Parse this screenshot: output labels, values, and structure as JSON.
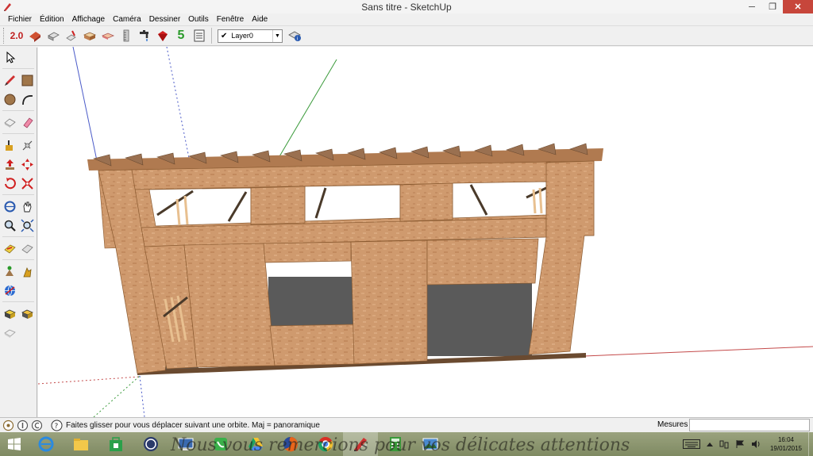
{
  "window": {
    "title": "Sans titre - SketchUp",
    "minimize_glyph": "─",
    "maximize_glyph": "❐",
    "close_glyph": "✕"
  },
  "menu": [
    "Fichier",
    "Édition",
    "Affichage",
    "Caméra",
    "Dessiner",
    "Outils",
    "Fenêtre",
    "Aide"
  ],
  "toolbar": {
    "version_badge": "2.0",
    "five_badge": "5",
    "icons": [
      "warehouse-2-icon",
      "push-block-icon",
      "paint-bucket-icon",
      "box-icon",
      "sandbox-icon",
      "ruler-icon",
      "faucet-icon",
      "red-gem-icon",
      "green-five-icon",
      "report-icon"
    ],
    "layer": {
      "check": "✔",
      "value": "Layer0",
      "arrow": "▼"
    },
    "layer_manager_icon": "layer-manager-icon"
  },
  "palette": {
    "rows": [
      [
        "select-icon"
      ],
      [
        "pencil-icon",
        "rectangle-icon"
      ],
      [
        "circle-icon",
        "arc-icon"
      ],
      [
        "eraser-icon",
        "paint-icon"
      ],
      [
        "move-icon",
        "push-pull-icon"
      ],
      [
        "push-pull-red-icon",
        "move-red-icon"
      ],
      [
        "rotate-icon",
        "scale-icon"
      ],
      [
        "orbit-icon",
        "pan-icon"
      ],
      [
        "zoom-icon",
        "zoom-extents-icon"
      ],
      [
        "walk-icon",
        "look-icon"
      ],
      [
        "position-camera-icon",
        "section-icon"
      ],
      [
        "globe-icon"
      ],
      [
        "component-icon",
        "group-icon"
      ],
      [
        "texture-icon"
      ]
    ]
  },
  "statusbar": {
    "hint": "Faites glisser pour vous déplacer suivant une orbite.  Maj = panoramique",
    "measure_label": "Mesures",
    "measure_value": ""
  },
  "taskbar": {
    "apps": [
      "internet-explorer-icon",
      "file-explorer-icon",
      "store-icon",
      "app-circle-icon",
      "remote-desktop-icon",
      "phone-icon",
      "drive-icon",
      "firefox-icon",
      "chrome-icon",
      "sketchup-icon",
      "calculator-icon",
      "photo-viewer-icon"
    ],
    "active_app": "sketchup-icon",
    "watermark": "Nous vous remercions pour vos délicates attentions",
    "time": "16:04",
    "date": "19/01/2015",
    "keyboard_icon": "keyboard-icon",
    "tray_icons": [
      "tray-arrow-icon",
      "network-icon",
      "flag-icon",
      "speaker-icon"
    ]
  },
  "colors": {
    "osb": "#cf9a6e",
    "osb_dark": "#b07a50",
    "axis_red": "#c44a4a",
    "axis_green": "#3a9a3a",
    "axis_blue": "#4a5ac8",
    "floor_grey": "#5a5a5a"
  }
}
